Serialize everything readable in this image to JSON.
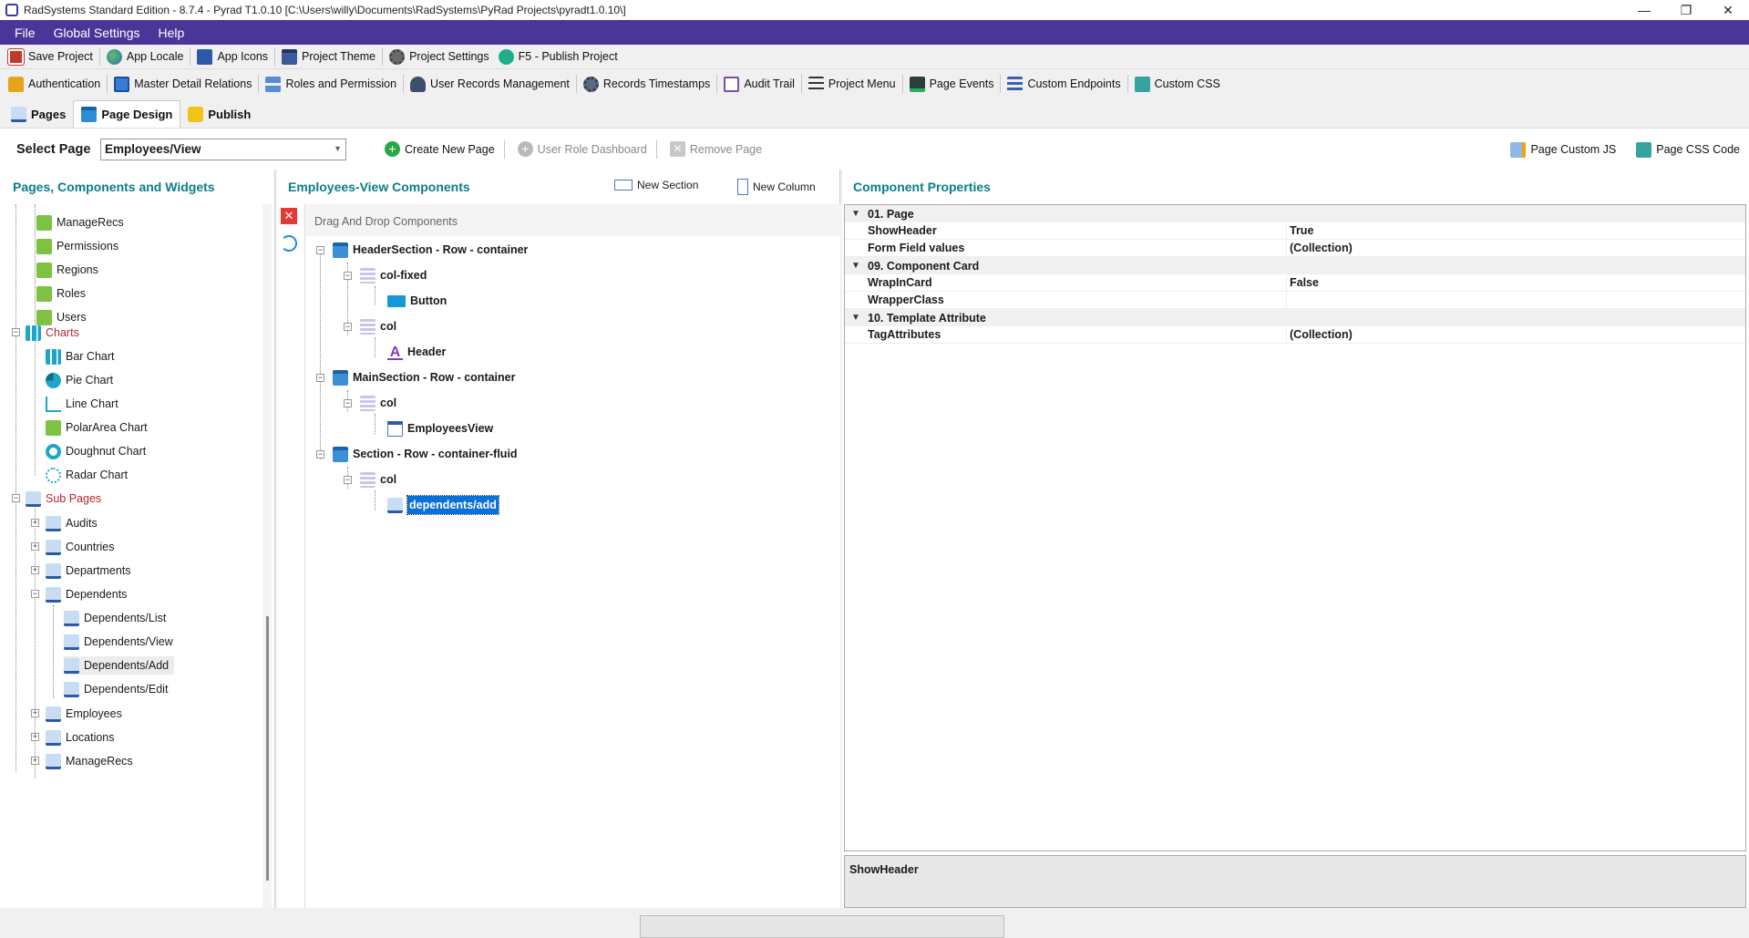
{
  "window": {
    "title": "RadSystems Standard Edition - 8.7.4 - Pyrad T1.0.10 [C:\\Users\\willy\\Documents\\RadSystems\\PyRad Projects\\pyradt1.0.10\\]",
    "minimize": "—",
    "maximize": "❐",
    "close": "✕"
  },
  "menu": [
    "File",
    "Global Settings",
    "Help"
  ],
  "toolbar1": [
    {
      "label": "Save Project",
      "icon": "save-icon"
    },
    {
      "label": "App Locale",
      "icon": "globe-icon"
    },
    {
      "label": "App Icons",
      "icon": "app-icons-icon"
    },
    {
      "label": "Project Theme",
      "icon": "theme-icon"
    },
    {
      "label": "Project Settings",
      "icon": "gear-icon"
    },
    {
      "label": "F5 - Publish Project",
      "icon": "play-icon"
    }
  ],
  "toolbar2": [
    {
      "label": "Authentication",
      "icon": "lock-icon"
    },
    {
      "label": "Master Detail Relations",
      "icon": "table-icon"
    },
    {
      "label": "Roles and Permission",
      "icon": "hierarchy-icon"
    },
    {
      "label": "User Records Management",
      "icon": "user-icon"
    },
    {
      "label": "Records Timestamps",
      "icon": "gears-icon"
    },
    {
      "label": "Audit Trail",
      "icon": "audit-icon"
    },
    {
      "label": "Project Menu",
      "icon": "menu-icon"
    },
    {
      "label": "Page Events",
      "icon": "chart-icon"
    },
    {
      "label": "Custom Endpoints",
      "icon": "list-icon"
    },
    {
      "label": "Custom CSS",
      "icon": "css-icon"
    }
  ],
  "tabs": [
    {
      "label": "Pages"
    },
    {
      "label": "Page Design"
    },
    {
      "label": "Publish"
    }
  ],
  "select_page": {
    "label": "Select Page",
    "value": "Employees/View",
    "create": "Create New Page",
    "dashboard": "User Role Dashboard",
    "remove": "Remove Page",
    "custom_js": "Page Custom JS",
    "custom_css": "Page CSS Code"
  },
  "left_panel": {
    "title": "Pages, Components and Widgets",
    "items": [
      {
        "label": "ManageRecs"
      },
      {
        "label": "Permissions"
      },
      {
        "label": "Regions"
      },
      {
        "label": "Roles"
      },
      {
        "label": "Users"
      },
      {
        "label": "Charts"
      },
      {
        "label": "Bar Chart"
      },
      {
        "label": "Pie Chart"
      },
      {
        "label": "Line Chart"
      },
      {
        "label": "PolarArea Chart"
      },
      {
        "label": "Doughnut Chart"
      },
      {
        "label": "Radar Chart"
      },
      {
        "label": "Sub Pages"
      },
      {
        "label": "Audits"
      },
      {
        "label": "Countries"
      },
      {
        "label": "Departments"
      },
      {
        "label": "Dependents"
      },
      {
        "label": "Dependents/List"
      },
      {
        "label": "Dependents/View"
      },
      {
        "label": "Dependents/Add"
      },
      {
        "label": "Dependents/Edit"
      },
      {
        "label": "Employees"
      },
      {
        "label": "Locations"
      },
      {
        "label": "ManageRecs"
      }
    ]
  },
  "mid_panel": {
    "title": "Employees-View Components",
    "new_section": "New Section",
    "new_column": "New Column",
    "dnd_label": "Drag And Drop Components",
    "nodes": [
      {
        "label": "HeaderSection - Row - container"
      },
      {
        "label": "col-fixed"
      },
      {
        "label": "Button"
      },
      {
        "label": "col"
      },
      {
        "label": "Header"
      },
      {
        "label": "MainSection - Row - container"
      },
      {
        "label": "col"
      },
      {
        "label": "EmployeesView"
      },
      {
        "label": "Section - Row - container-fluid"
      },
      {
        "label": "col"
      },
      {
        "label": "dependents/add"
      }
    ]
  },
  "properties": {
    "title": "Component Properties",
    "rows": [
      {
        "name": "01. Page",
        "value": ""
      },
      {
        "name": "ShowHeader",
        "value": "True"
      },
      {
        "name": "Form Field values",
        "value": "(Collection)"
      },
      {
        "name": "09. Component Card",
        "value": ""
      },
      {
        "name": "WrapInCard",
        "value": "False"
      },
      {
        "name": "WrapperClass",
        "value": ""
      },
      {
        "name": "10. Template Attribute",
        "value": ""
      },
      {
        "name": "TagAttributes",
        "value": "(Collection)"
      }
    ],
    "description": "ShowHeader"
  }
}
